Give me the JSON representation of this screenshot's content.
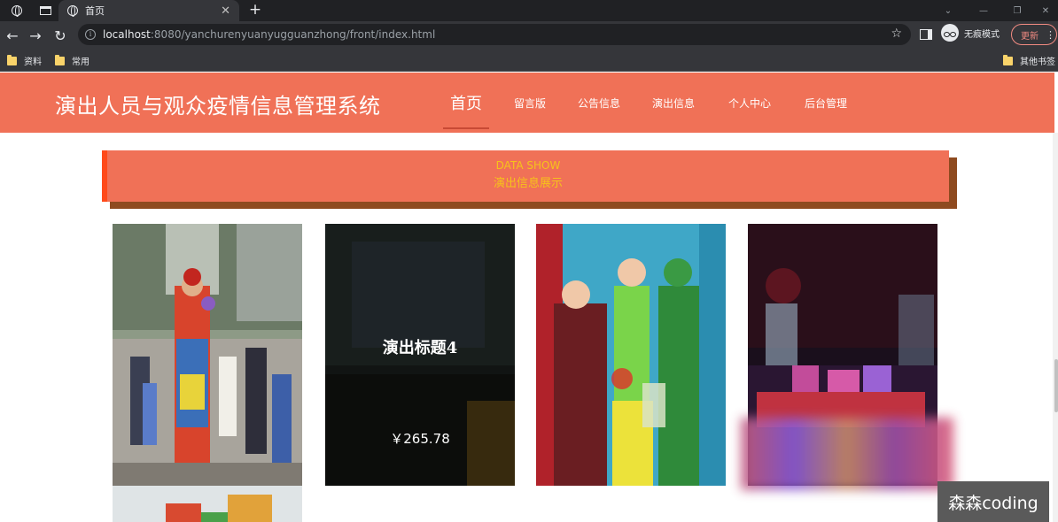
{
  "browser": {
    "tab_title": "首页",
    "url_host": "localhost",
    "url_rest": ":8080/yanchurenyuanyugguanzhong/front/index.html",
    "profile_label": "无痕模式",
    "update_label": "更新",
    "bookmarks": [
      "资料",
      "常用"
    ],
    "other_bookmarks": "其他书签"
  },
  "site": {
    "title": "演出人员与观众疫情信息管理系统",
    "nav": [
      "首页",
      "留言版",
      "公告信息",
      "演出信息",
      "个人中心",
      "后台管理"
    ]
  },
  "section": {
    "en": "DATA SHOW",
    "cn": "演出信息展示"
  },
  "cards": [
    {
      "photo": "clown-performer-crowd",
      "title": "",
      "price": ""
    },
    {
      "photo": "stage-performance",
      "title": "演出标题4",
      "price": "￥265.78"
    },
    {
      "photo": "children-costume-play",
      "title": "",
      "price": ""
    },
    {
      "photo": "dance-stage-red",
      "title": "",
      "price": ""
    }
  ],
  "watermark": "森森coding",
  "colors": {
    "header": "#f07157",
    "banner_text": "#f6c21a",
    "banner_left": "#ff4a1a"
  }
}
